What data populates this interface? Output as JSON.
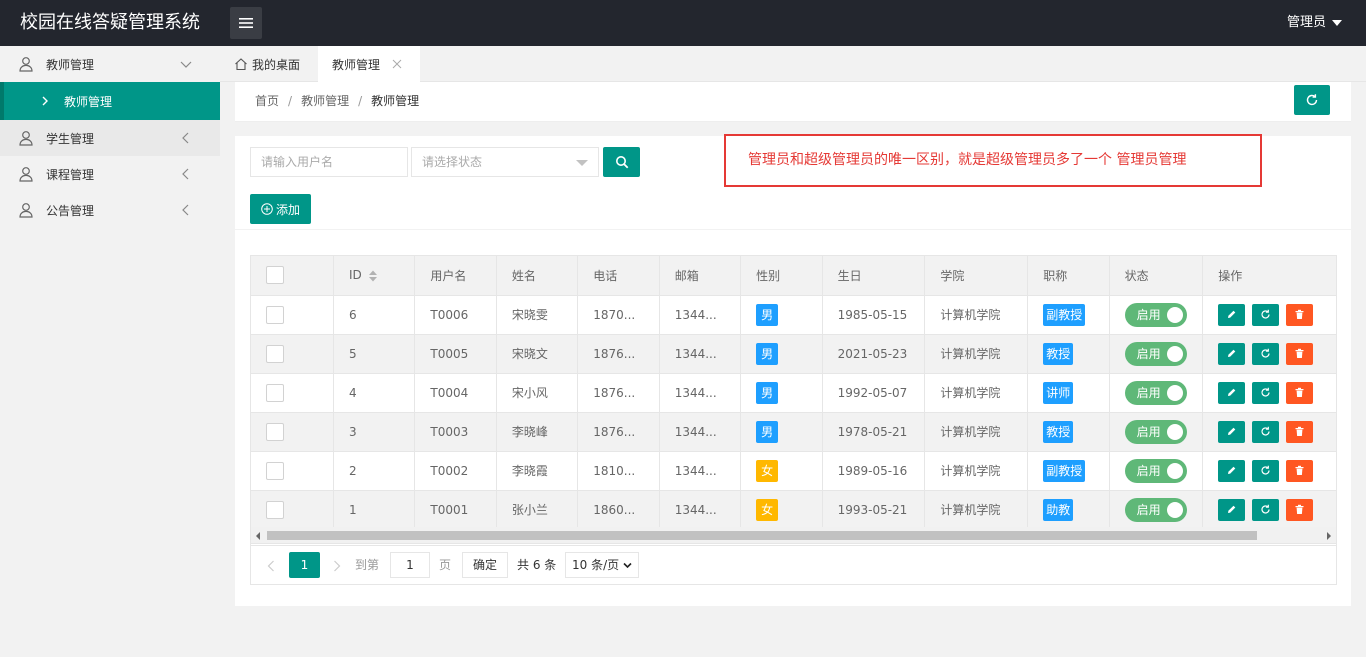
{
  "app": {
    "title": "校园在线答疑管理系统",
    "user": "管理员"
  },
  "sidebar": {
    "items": [
      {
        "label": "教师管理"
      },
      {
        "label": "教师管理"
      },
      {
        "label": "学生管理"
      },
      {
        "label": "课程管理"
      },
      {
        "label": "公告管理"
      }
    ]
  },
  "tabs": [
    {
      "label": "我的桌面"
    },
    {
      "label": "教师管理"
    }
  ],
  "breadcrumb": [
    "首页",
    "教师管理",
    "教师管理"
  ],
  "search": {
    "username_placeholder": "请输入用户名",
    "status_placeholder": "请选择状态",
    "add_label": "添加"
  },
  "notice": "管理员和超级管理员的唯一区别，就是超级管理员多了一个  管理员管理",
  "table": {
    "headers": [
      "ID",
      "用户名",
      "姓名",
      "电话",
      "邮箱",
      "性别",
      "生日",
      "学院",
      "职称",
      "状态",
      "操作"
    ],
    "rows": [
      {
        "id": "6",
        "username": "T0006",
        "name": "宋晓雯",
        "phone": "1870...",
        "email": "1344...",
        "gender": "男",
        "birthday": "1985-05-15",
        "college": "计算机学院",
        "title": "副教授",
        "status": "启用"
      },
      {
        "id": "5",
        "username": "T0005",
        "name": "宋晓文",
        "phone": "1876...",
        "email": "1344...",
        "gender": "男",
        "birthday": "2021-05-23",
        "college": "计算机学院",
        "title": "教授",
        "status": "启用"
      },
      {
        "id": "4",
        "username": "T0004",
        "name": "宋小风",
        "phone": "1876...",
        "email": "1344...",
        "gender": "男",
        "birthday": "1992-05-07",
        "college": "计算机学院",
        "title": "讲师",
        "status": "启用"
      },
      {
        "id": "3",
        "username": "T0003",
        "name": "李晓峰",
        "phone": "1876...",
        "email": "1344...",
        "gender": "男",
        "birthday": "1978-05-21",
        "college": "计算机学院",
        "title": "教授",
        "status": "启用"
      },
      {
        "id": "2",
        "username": "T0002",
        "name": "李晓霞",
        "phone": "1810...",
        "email": "1344...",
        "gender": "女",
        "birthday": "1989-05-16",
        "college": "计算机学院",
        "title": "副教授",
        "status": "启用"
      },
      {
        "id": "1",
        "username": "T0001",
        "name": "张小兰",
        "phone": "1860...",
        "email": "1344...",
        "gender": "女",
        "birthday": "1993-05-21",
        "college": "计算机学院",
        "title": "助教",
        "status": "启用"
      }
    ]
  },
  "pagination": {
    "current": "1",
    "goto_label": "到第",
    "page_input": "1",
    "page_label": "页",
    "confirm": "确定",
    "total": "共 6 条",
    "page_size": "10 条/页"
  },
  "colors": {
    "primary": "#009688",
    "header_bg": "#23262e",
    "male": "#1e9fff",
    "female": "#ffb800",
    "title_badge": "#1e9fff",
    "switch_on": "#5fb878",
    "delete": "#ff5722",
    "notice": "#e53935"
  },
  "icons": {
    "menu": "hamburger-icon",
    "user": "user-icon",
    "home": "home-icon",
    "refresh": "refresh-icon",
    "search": "search-icon",
    "add": "plus-circle-icon",
    "edit": "pencil-icon",
    "reset": "refresh-icon",
    "delete": "trash-icon"
  }
}
